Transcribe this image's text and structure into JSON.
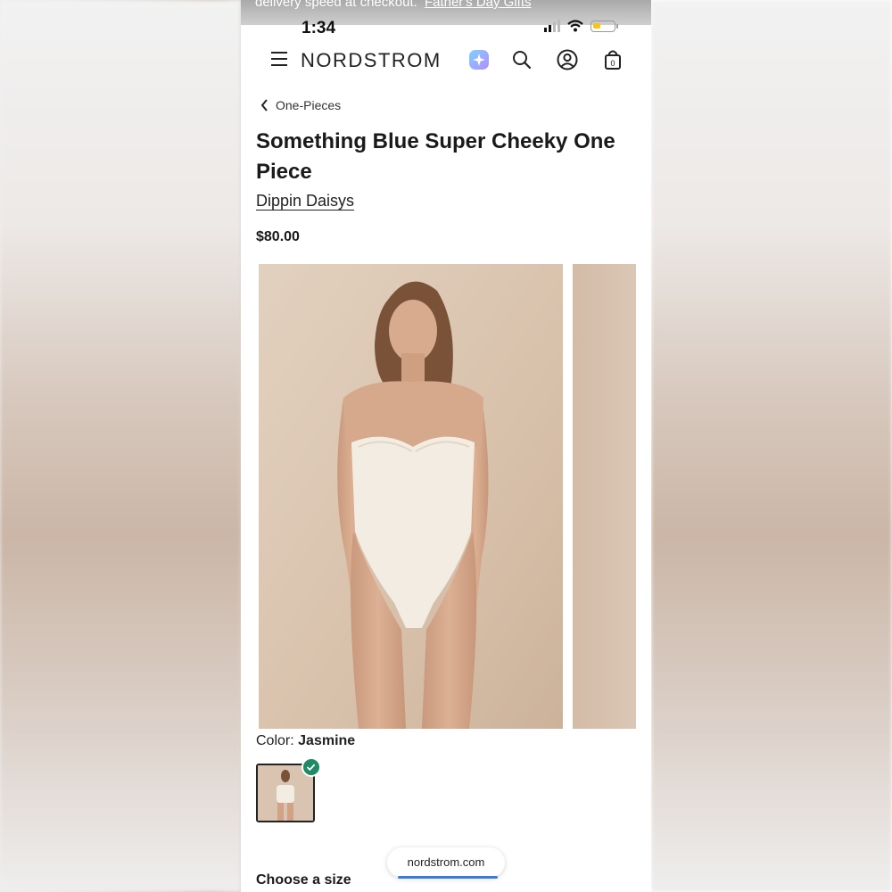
{
  "promo": {
    "text": "delivery speed at checkout.",
    "link": "Father's Day Gifts"
  },
  "status_bar": {
    "time": "1:34"
  },
  "header": {
    "logo": "NORDSTROM"
  },
  "breadcrumb": {
    "label": "One-Pieces"
  },
  "product": {
    "title": "Something Blue Super Cheeky One Piece",
    "brand": "Dippin Daisys",
    "price": "$80.00",
    "color_label": "Color:",
    "color_value": "Jasmine"
  },
  "size": {
    "label": "Choose a size"
  },
  "browser": {
    "url": "nordstrom.com"
  },
  "colors": {
    "check": "#1f8a63",
    "url_bar": "#3a7bd5"
  }
}
